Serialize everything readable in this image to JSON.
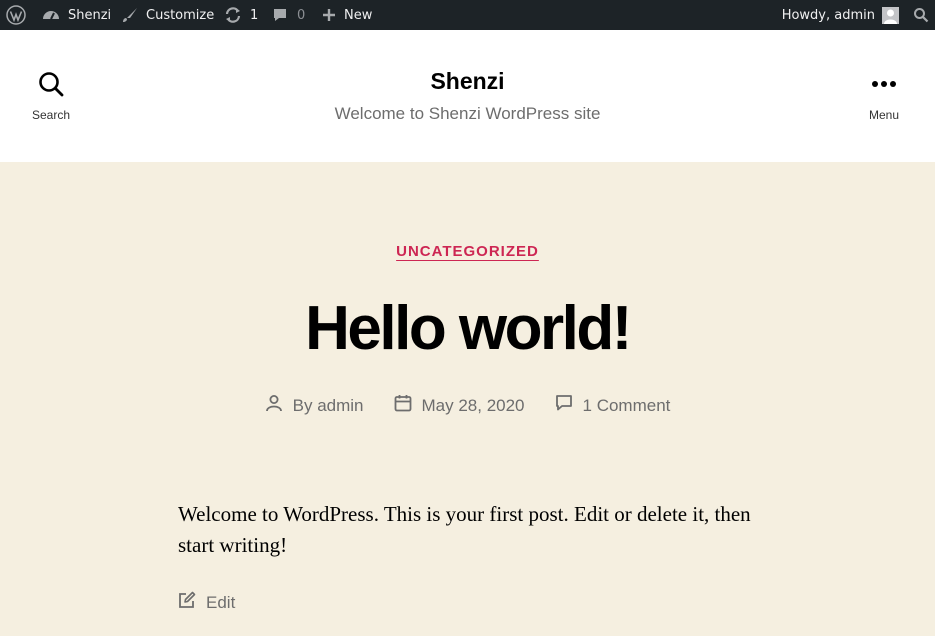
{
  "admin_bar": {
    "site_name": "Shenzi",
    "customize": "Customize",
    "updates_count": "1",
    "comments_count": "0",
    "new_label": "New",
    "greeting": "Howdy, admin"
  },
  "header": {
    "search_label": "Search",
    "site_title": "Shenzi",
    "site_description": "Welcome to Shenzi WordPress site",
    "menu_label": "Menu"
  },
  "post": {
    "category": "UNCATEGORIZED",
    "title": "Hello world!",
    "author_prefix": "By",
    "author": "admin",
    "date": "May 28, 2020",
    "comments": "1 Comment",
    "body": "Welcome to WordPress. This is your first post. Edit or delete it, then start writing!",
    "edit_label": "Edit"
  },
  "colors": {
    "admin_bar_bg": "#1d2327",
    "page_bg": "#f5efe0",
    "accent": "#cd2653",
    "meta_text": "#6d6d6d"
  }
}
